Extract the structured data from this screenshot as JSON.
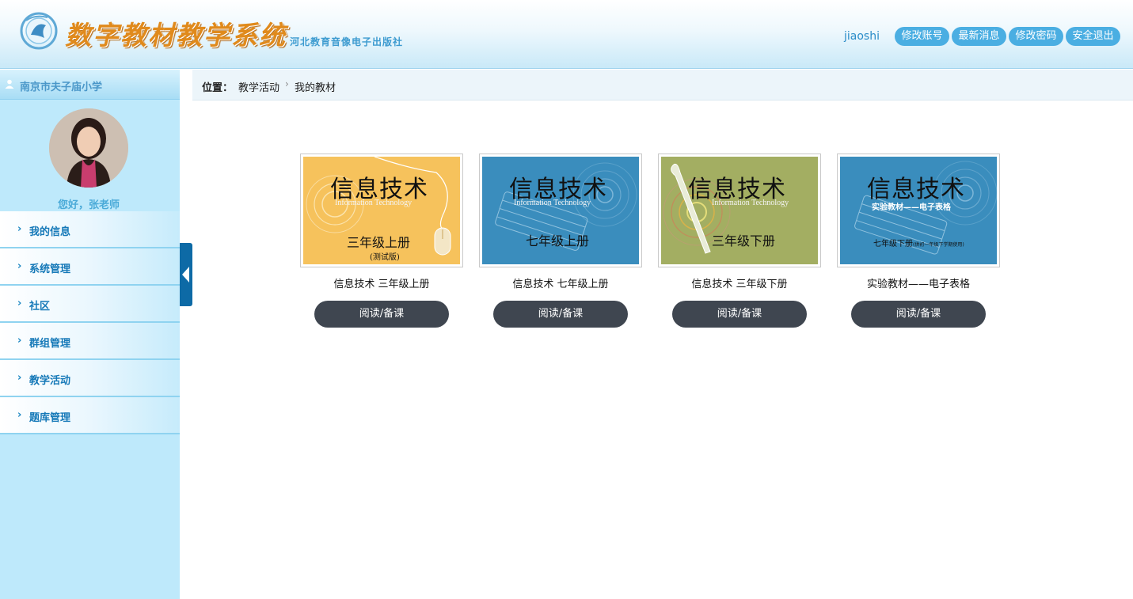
{
  "header": {
    "logo_title": "数字教材教学系统",
    "publisher": "河北教育音像电子出版社",
    "username": "jiaoshi",
    "buttons": [
      "修改账号",
      "最新消息",
      "修改密码",
      "安全退出"
    ]
  },
  "sidebar": {
    "school": "南京市夫子庙小学",
    "greeting": "您好，张老师",
    "items": [
      {
        "label": "我的信息"
      },
      {
        "label": "系统管理"
      },
      {
        "label": "社区"
      },
      {
        "label": "群组管理"
      },
      {
        "label": "教学活动"
      },
      {
        "label": "题库管理"
      }
    ]
  },
  "breadcrumb": {
    "label": "位置：",
    "items": [
      "教学活动",
      "我的教材"
    ]
  },
  "books": [
    {
      "name": "信息技术 三年级上册",
      "cover_title": "信息技术",
      "cover_en": "Information Technology",
      "cover_grade": "三年级上册",
      "cover_note": "(测试版)",
      "cover_color": "#f6c25c",
      "button": "阅读/备课"
    },
    {
      "name": "信息技术 七年级上册",
      "cover_title": "信息技术",
      "cover_en": "Information Technology",
      "cover_grade": "七年级上册",
      "cover_color": "#3a8dbd",
      "button": "阅读/备课"
    },
    {
      "name": "信息技术 三年级下册",
      "cover_title": "信息技术",
      "cover_en": "Information Technology",
      "cover_grade": "三年级下册",
      "cover_color": "#a3ae62",
      "button": "阅读/备课"
    },
    {
      "name": "实验教材——电子表格",
      "cover_title": "信息技术",
      "cover_sub": "实验教材——电子表格",
      "cover_grade": "七年级下册",
      "cover_grade_note": "(供初一年级下学期使用)",
      "cover_color": "#3a8dbd",
      "button": "阅读/备课"
    }
  ],
  "colors": {
    "accent": "#4aaee2",
    "sidebar_bg": "#bee9fb",
    "menu_text": "#1679b8",
    "button_dark": "#3f4650"
  }
}
